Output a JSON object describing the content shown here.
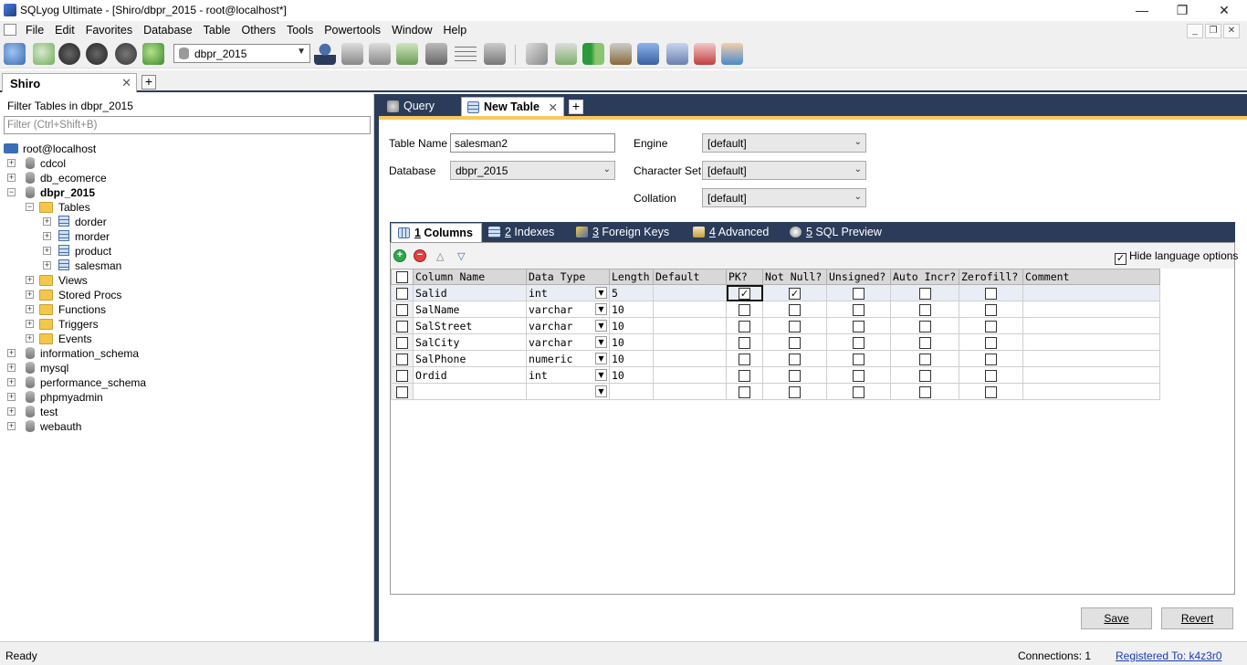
{
  "window": {
    "title": "SQLyog Ultimate - [Shiro/dbpr_2015 - root@localhost*]",
    "minimize": "—",
    "maximize": "❐",
    "close": "✕"
  },
  "menu": [
    "File",
    "Edit",
    "Favorites",
    "Database",
    "Table",
    "Others",
    "Tools",
    "Powertools",
    "Window",
    "Help"
  ],
  "toolbar": {
    "database_selector": "dbpr_2015"
  },
  "connection_tab": {
    "label": "Shiro",
    "close": "✕",
    "add": "+"
  },
  "left": {
    "filter_label": "Filter Tables in dbpr_2015",
    "filter_placeholder": "Filter (Ctrl+Shift+B)",
    "root": "root@localhost",
    "databases": [
      "cdcol",
      "db_ecomerce",
      "dbpr_2015",
      "information_schema",
      "mysql",
      "performance_schema",
      "phpmyadmin",
      "test",
      "webauth"
    ],
    "folders": [
      "Tables",
      "Views",
      "Stored Procs",
      "Functions",
      "Triggers",
      "Events"
    ],
    "tables": [
      "dorder",
      "morder",
      "product",
      "salesman"
    ]
  },
  "query_tabs": [
    {
      "label": "Query"
    },
    {
      "label": "New Table",
      "close": "✕"
    }
  ],
  "form": {
    "table_name_label": "Table Name",
    "table_name": "salesman2",
    "database_label": "Database",
    "database": "dbpr_2015",
    "engine_label": "Engine",
    "engine": "[default]",
    "charset_label": "Character Set",
    "charset": "[default]",
    "collation_label": "Collation",
    "collation": "[default]"
  },
  "inner_tabs": [
    {
      "num": "1",
      "label": " Columns"
    },
    {
      "num": "2",
      "label": " Indexes"
    },
    {
      "num": "3",
      "label": " Foreign Keys"
    },
    {
      "num": "4",
      "label": " Advanced"
    },
    {
      "num": "5",
      "label": " SQL Preview"
    }
  ],
  "hide_language_options": "Hide language options",
  "columns_header": [
    "Column Name",
    "Data Type",
    "Length",
    "Default",
    "PK?",
    "Not Null?",
    "Unsigned?",
    "Auto Incr?",
    "Zerofill?",
    "Comment"
  ],
  "rows": [
    {
      "name": "Salid",
      "type": "int",
      "length": "5",
      "pk": true,
      "notnull": true
    },
    {
      "name": "SalName",
      "type": "varchar",
      "length": "10",
      "pk": false,
      "notnull": false
    },
    {
      "name": "SalStreet",
      "type": "varchar",
      "length": "10",
      "pk": false,
      "notnull": false
    },
    {
      "name": "SalCity",
      "type": "varchar",
      "length": "10",
      "pk": false,
      "notnull": false
    },
    {
      "name": "SalPhone",
      "type": "numeric",
      "length": "10",
      "pk": false,
      "notnull": false
    },
    {
      "name": "Ordid",
      "type": "int",
      "length": "10",
      "pk": false,
      "notnull": false
    },
    {
      "name": "",
      "type": "",
      "length": "",
      "pk": false,
      "notnull": false
    }
  ],
  "buttons": {
    "save": "Save",
    "revert": "Revert"
  },
  "status": {
    "ready": "Ready",
    "connections": "Connections: 1",
    "registered": "Registered To: k4z3r0"
  },
  "colors": {
    "dark_navy": "#2b3b5a",
    "accent_orange": "#f7c85c",
    "link_blue": "#1a3cb8"
  }
}
